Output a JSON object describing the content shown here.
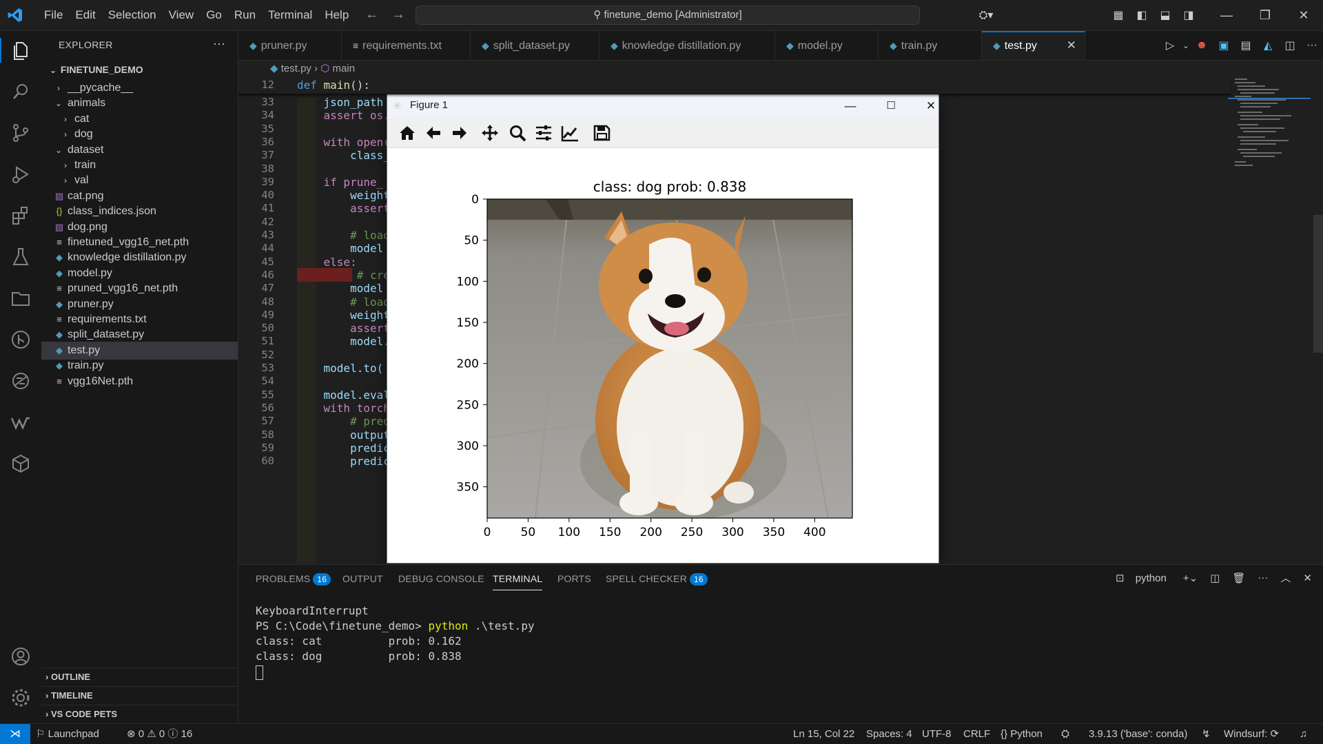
{
  "titlebar": {
    "menu": [
      "File",
      "Edit",
      "Selection",
      "View",
      "Go",
      "Run",
      "Terminal",
      "Help"
    ],
    "command_center": "finetune_demo [Administrator]"
  },
  "explorer": {
    "header": "EXPLORER",
    "root": "FINETUNE_DEMO",
    "items": [
      {
        "label": "__pycache__",
        "type": "folder-closed",
        "indent": 1
      },
      {
        "label": "animals",
        "type": "folder-open",
        "indent": 1
      },
      {
        "label": "cat",
        "type": "folder-closed",
        "indent": 2
      },
      {
        "label": "dog",
        "type": "folder-closed",
        "indent": 2
      },
      {
        "label": "dataset",
        "type": "folder-open",
        "indent": 1
      },
      {
        "label": "train",
        "type": "folder-closed",
        "indent": 2
      },
      {
        "label": "val",
        "type": "folder-closed",
        "indent": 2
      },
      {
        "label": "cat.png",
        "type": "image",
        "indent": 1
      },
      {
        "label": "class_indices.json",
        "type": "json",
        "indent": 1
      },
      {
        "label": "dog.png",
        "type": "image",
        "indent": 1
      },
      {
        "label": "finetuned_vgg16_net.pth",
        "type": "text",
        "indent": 1
      },
      {
        "label": "knowledge distillation.py",
        "type": "python",
        "indent": 1
      },
      {
        "label": "model.py",
        "type": "python",
        "indent": 1
      },
      {
        "label": "pruned_vgg16_net.pth",
        "type": "text",
        "indent": 1
      },
      {
        "label": "pruner.py",
        "type": "python",
        "indent": 1
      },
      {
        "label": "requirements.txt",
        "type": "text",
        "indent": 1
      },
      {
        "label": "split_dataset.py",
        "type": "python",
        "indent": 1
      },
      {
        "label": "test.py",
        "type": "python",
        "indent": 1,
        "selected": true
      },
      {
        "label": "train.py",
        "type": "python",
        "indent": 1
      },
      {
        "label": "vgg16Net.pth",
        "type": "text",
        "indent": 1
      }
    ],
    "sections": [
      "OUTLINE",
      "TIMELINE",
      "VS CODE PETS"
    ]
  },
  "tabs": [
    {
      "label": "pruner.py",
      "icon": "python"
    },
    {
      "label": "requirements.txt",
      "icon": "text"
    },
    {
      "label": "split_dataset.py",
      "icon": "python"
    },
    {
      "label": "knowledge distillation.py",
      "icon": "python"
    },
    {
      "label": "model.py",
      "icon": "python"
    },
    {
      "label": "train.py",
      "icon": "python"
    },
    {
      "label": "test.py",
      "icon": "python",
      "active": true
    }
  ],
  "breadcrumb": {
    "file": "test.py",
    "symbol": "main"
  },
  "editor": {
    "sticky": {
      "line": "12",
      "code": "def main():"
    },
    "lines": [
      {
        "n": "33",
        "code": "    json_path"
      },
      {
        "n": "34",
        "code": "    assert os."
      },
      {
        "n": "35",
        "code": ""
      },
      {
        "n": "36",
        "code": "    with open("
      },
      {
        "n": "37",
        "code": "        class_"
      },
      {
        "n": "38",
        "code": ""
      },
      {
        "n": "39",
        "code": "    if prune_"
      },
      {
        "n": "40",
        "code": "        weight"
      },
      {
        "n": "41",
        "code": "        assert"
      },
      {
        "n": "42",
        "code": ""
      },
      {
        "n": "43",
        "code": "        # load"
      },
      {
        "n": "44",
        "code": "        model"
      },
      {
        "n": "45",
        "code": "    else:"
      },
      {
        "n": "46",
        "code": "         # cre"
      },
      {
        "n": "47",
        "code": "        model"
      },
      {
        "n": "48",
        "code": "        # load"
      },
      {
        "n": "49",
        "code": "        weight"
      },
      {
        "n": "50",
        "code": "        assert"
      },
      {
        "n": "51",
        "code": "        model."
      },
      {
        "n": "52",
        "code": ""
      },
      {
        "n": "53",
        "code": "    model.to("
      },
      {
        "n": "54",
        "code": ""
      },
      {
        "n": "55",
        "code": "    model.eval"
      },
      {
        "n": "56",
        "code": "    with torch"
      },
      {
        "n": "57",
        "code": "        # pred"
      },
      {
        "n": "58",
        "code": "        output"
      },
      {
        "n": "59",
        "code": "        predic"
      },
      {
        "n": "60",
        "code": "        predic"
      }
    ]
  },
  "figure": {
    "window_title": "Figure 1",
    "toolbar": [
      "home-icon",
      "back-icon",
      "forward-icon",
      "pan-icon",
      "zoom-icon",
      "configure-icon",
      "edit-axis-icon",
      "save-icon"
    ]
  },
  "chart_data": {
    "type": "image",
    "title": "class: dog   prob: 0.838",
    "xlabel": "",
    "ylabel": "",
    "xticks": [
      0,
      50,
      100,
      150,
      200,
      250,
      300,
      350,
      400
    ],
    "yticks": [
      0,
      50,
      100,
      150,
      200,
      250,
      300,
      350
    ],
    "xlim": [
      0,
      446
    ],
    "ylim": [
      388,
      0
    ],
    "image_content": "corgi dog sitting on pavement"
  },
  "panel": {
    "tabs": [
      {
        "label": "PROBLEMS",
        "badge": "16"
      },
      {
        "label": "OUTPUT"
      },
      {
        "label": "DEBUG CONSOLE"
      },
      {
        "label": "TERMINAL",
        "active": true
      },
      {
        "label": "PORTS"
      },
      {
        "label": "SPELL CHECKER",
        "badge": "16"
      }
    ],
    "terminal_name": "python",
    "terminal": {
      "l1": "KeyboardInterrupt",
      "prompt": "PS C:\\Code\\finetune_demo> ",
      "cmd": "python",
      "arg": " .\\test.py",
      "l3": "class: cat          prob: 0.162",
      "l4": "class: dog          prob: 0.838"
    }
  },
  "statusbar": {
    "launchpad": "Launchpad",
    "errors": "0",
    "warnings": "0",
    "info": "16",
    "position": "Ln 15, Col 22",
    "spaces": "Spaces: 4",
    "encoding": "UTF-8",
    "eol": "CRLF",
    "language": "Python",
    "interpreter": "3.9.13 ('base': conda)",
    "windsurf": "Windsurf:"
  },
  "colors": {
    "accent": "#0078d4",
    "python_icon": "#519aba",
    "terminal_cmd": "#e5e510"
  }
}
